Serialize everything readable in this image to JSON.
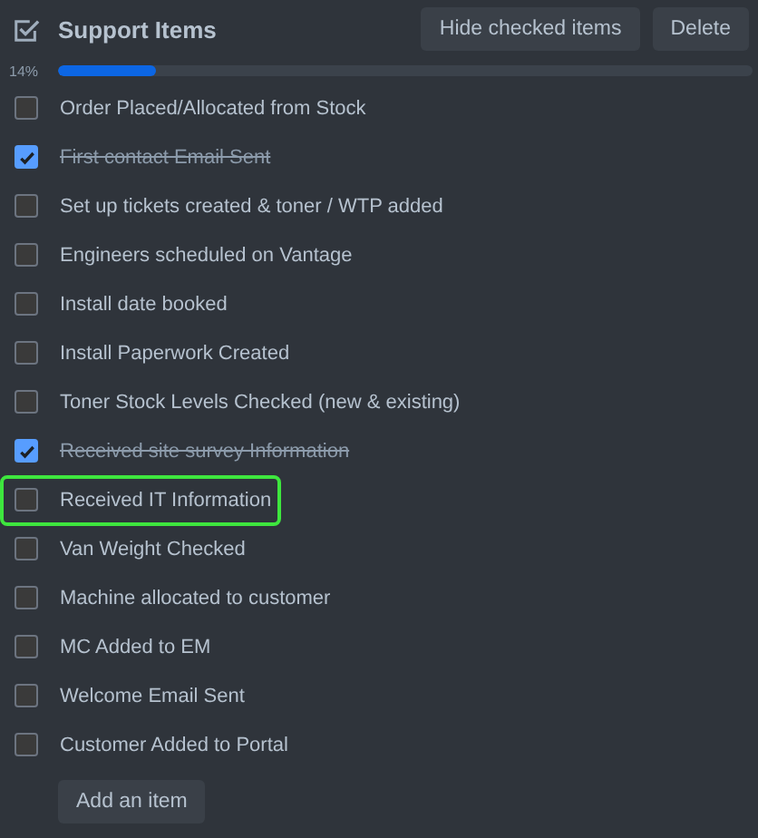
{
  "header": {
    "title": "Support Items",
    "buttons": [
      "Hide checked items",
      "Delete"
    ]
  },
  "progress": {
    "label": "14%",
    "level": 0.14
  },
  "items": [
    {
      "label": "Order Placed/Allocated from Stock",
      "checked": false,
      "highlighted": false
    },
    {
      "label": "First contact Email Sent",
      "checked": true,
      "highlighted": false
    },
    {
      "label": "Set up tickets created & toner / WTP added",
      "checked": false,
      "highlighted": false
    },
    {
      "label": "Engineers scheduled on Vantage",
      "checked": false,
      "highlighted": false
    },
    {
      "label": "Install date booked",
      "checked": false,
      "highlighted": false
    },
    {
      "label": "Install Paperwork Created",
      "checked": false,
      "highlighted": false
    },
    {
      "label": "Toner Stock Levels Checked (new & existing)",
      "checked": false,
      "highlighted": false
    },
    {
      "label": "Received site survey Information",
      "checked": true,
      "highlighted": false
    },
    {
      "label": "Received IT Information",
      "checked": false,
      "highlighted": true
    },
    {
      "label": "Van Weight Checked",
      "checked": false,
      "highlighted": false
    },
    {
      "label": "Machine allocated to customer",
      "checked": false,
      "highlighted": false
    },
    {
      "label": "MC Added to EM",
      "checked": false,
      "highlighted": false
    },
    {
      "label": "Welcome Email Sent",
      "checked": false,
      "highlighted": false
    },
    {
      "label": "Customer Added to Portal",
      "checked": false,
      "highlighted": false
    }
  ],
  "add_button": "Add an item"
}
